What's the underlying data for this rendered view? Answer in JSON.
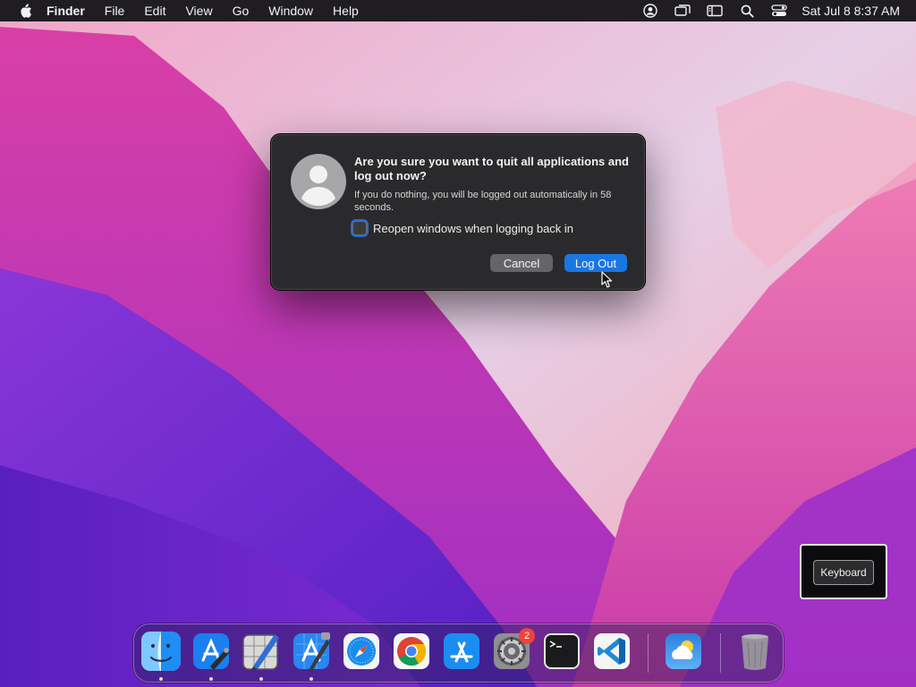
{
  "menubar": {
    "app_name": "Finder",
    "items": [
      "File",
      "Edit",
      "View",
      "Go",
      "Window",
      "Help"
    ],
    "status_icons": [
      "user-icon",
      "screen-mirroring-icon",
      "sidebar-icon",
      "search-icon",
      "control-center-icon"
    ],
    "clock": "Sat Jul 8  8:37 AM"
  },
  "dialog": {
    "title": "Are you sure you want to quit all applications and log out now?",
    "message": "If you do nothing, you will be logged out automatically in 58 seconds.",
    "checkbox_label": "Reopen windows when logging back in",
    "checkbox_checked": false,
    "cancel_label": "Cancel",
    "logout_label": "Log Out",
    "accent_color": "#1a76e3"
  },
  "keyboard_panel": {
    "button_label": "Keyboard"
  },
  "dock": {
    "items": [
      {
        "icon": "finder-icon",
        "running": true
      },
      {
        "icon": "xcode-instruments-icon",
        "running": true
      },
      {
        "icon": "sketch-pencil-icon",
        "running": true
      },
      {
        "icon": "xcode-icon",
        "running": true
      },
      {
        "icon": "safari-icon",
        "running": false
      },
      {
        "icon": "chrome-icon",
        "running": false
      },
      {
        "icon": "app-store-icon",
        "running": false
      },
      {
        "icon": "system-settings-icon",
        "running": false,
        "badge": "2"
      },
      {
        "icon": "terminal-icon",
        "running": false
      },
      {
        "icon": "vscode-icon",
        "running": false
      },
      {
        "icon": "weather-icon",
        "running": false
      },
      {
        "icon": "trash-icon",
        "running": false
      }
    ]
  }
}
